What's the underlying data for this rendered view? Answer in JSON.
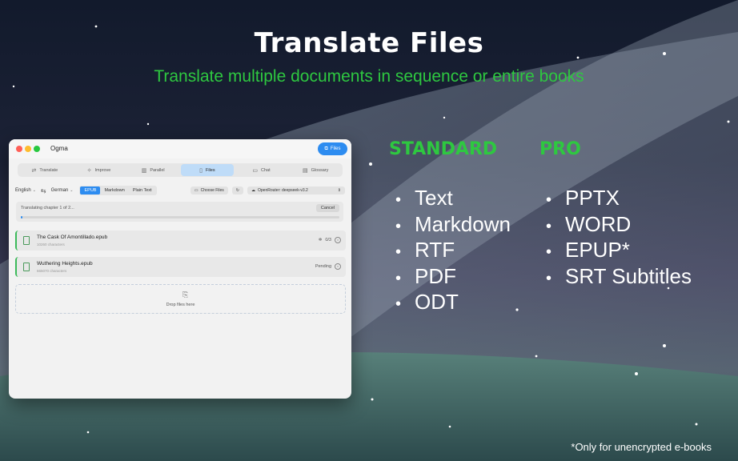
{
  "hero": {
    "title": "Translate Files",
    "subtitle": "Translate multiple documents in sequence or entire books"
  },
  "window": {
    "app_title": "Ogma",
    "header_button": {
      "label": "Files",
      "icon": "files-icon"
    },
    "tabs": [
      {
        "label": "Translate",
        "icon": "translate-icon",
        "active": false
      },
      {
        "label": "Improve",
        "icon": "sparkle-icon",
        "active": false
      },
      {
        "label": "Parallel",
        "icon": "columns-icon",
        "active": false
      },
      {
        "label": "Files",
        "icon": "file-icon",
        "active": true
      },
      {
        "label": "Chat",
        "icon": "chat-icon",
        "active": false
      },
      {
        "label": "Glossary",
        "icon": "book-icon",
        "active": false
      }
    ],
    "toolbar": {
      "source_lang": "English",
      "target_lang": "German",
      "formats": [
        "EPUB",
        "Markdown",
        "Plain Text"
      ],
      "active_format": "EPUB",
      "choose_files": "Choose Files",
      "model": "OpenRouter: deepseek-v3.2"
    },
    "progress": {
      "text": "Translating chapter 1 of 2...",
      "cancel": "Cancel",
      "fraction": 0.005
    },
    "files": [
      {
        "name": "The Cask Of Amontillado.epub",
        "sub": "10260 characters",
        "status": "0/3"
      },
      {
        "name": "Wuthering Heights.epub",
        "sub": "665070 characters",
        "status": "Pending"
      }
    ],
    "dropzone": {
      "label": "Drop files here"
    }
  },
  "standard": {
    "heading": "STANDARD",
    "items": [
      "Text",
      "Markdown",
      "RTF",
      "PDF",
      "ODT"
    ]
  },
  "pro": {
    "heading": "PRO",
    "items": [
      "PPTX",
      "WORD",
      "EPUP*",
      "SRT Subtitles"
    ]
  },
  "footnote": "*Only for unencrypted e-books",
  "colors": {
    "accent_green": "#2ec840",
    "accent_blue": "#2d8cf0"
  }
}
